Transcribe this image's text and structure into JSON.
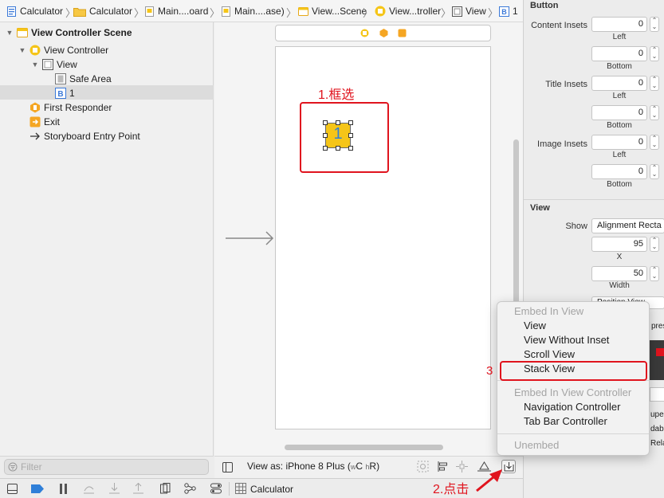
{
  "breadcrumb": [
    {
      "label": "Calculator",
      "icon": "project-file-icon"
    },
    {
      "label": "Calculator",
      "icon": "folder-icon"
    },
    {
      "label": "Main....oard",
      "icon": "storyboard-file-icon"
    },
    {
      "label": "Main....ase)",
      "icon": "storyboard-file-icon"
    },
    {
      "label": "View...Scene",
      "icon": "scene-icon"
    },
    {
      "label": "View...troller",
      "icon": "view-controller-icon"
    },
    {
      "label": "View",
      "icon": "view-icon"
    },
    {
      "label": "1",
      "icon": "button-icon"
    }
  ],
  "outline": {
    "scene": "View Controller Scene",
    "view_controller": "View Controller",
    "view": "View",
    "safe_area": "Safe Area",
    "button": "1",
    "first_responder": "First Responder",
    "exit": "Exit",
    "entry_point": "Storyboard Entry Point",
    "filter_placeholder": "Filter"
  },
  "canvas": {
    "button_title": "1",
    "view_as_prefix": "View as: iPhone 8 Plus (",
    "size_w": "w",
    "size_c": "C",
    "size_h": "h",
    "size_r": "R",
    "view_as_suffix": ")"
  },
  "debug": {
    "scheme": "Calculator"
  },
  "inspector": {
    "section_button": "Button",
    "content_insets_label": "Content Insets",
    "content_left": "0",
    "content_bottom": "0",
    "title_insets_label": "Title Insets",
    "title_left": "0",
    "title_bottom": "0",
    "image_insets_label": "Image Insets",
    "image_left": "0",
    "image_bottom": "0",
    "left_caption": "Left",
    "bottom_caption": "Bottom",
    "section_view": "View",
    "show_label": "Show",
    "show_value": "Alignment Recta",
    "x_value": "95",
    "x_caption": "X",
    "width_value": "50",
    "width_caption": "Width",
    "partial_1": "Position View",
    "partial_2": "pres",
    "partial_3": "upe",
    "partial_4": "dab",
    "partial_5": "Rela"
  },
  "menu": {
    "header_view": "Embed In View",
    "items_view": [
      "View",
      "View Without Inset",
      "Scroll View",
      "Stack View"
    ],
    "header_controller": "Embed In View Controller",
    "items_controller": [
      "Navigation Controller",
      "Tab Bar Controller"
    ],
    "unembed": "Unembed"
  },
  "annotations": {
    "step1": "1.框选",
    "step2": "2.点击",
    "step3": "3"
  },
  "colors": {
    "annotation_red": "#e0141e",
    "selection_yellow": "#f5c518",
    "button_text_blue": "#2f7fd8",
    "icon_orange": "#f5a623"
  }
}
